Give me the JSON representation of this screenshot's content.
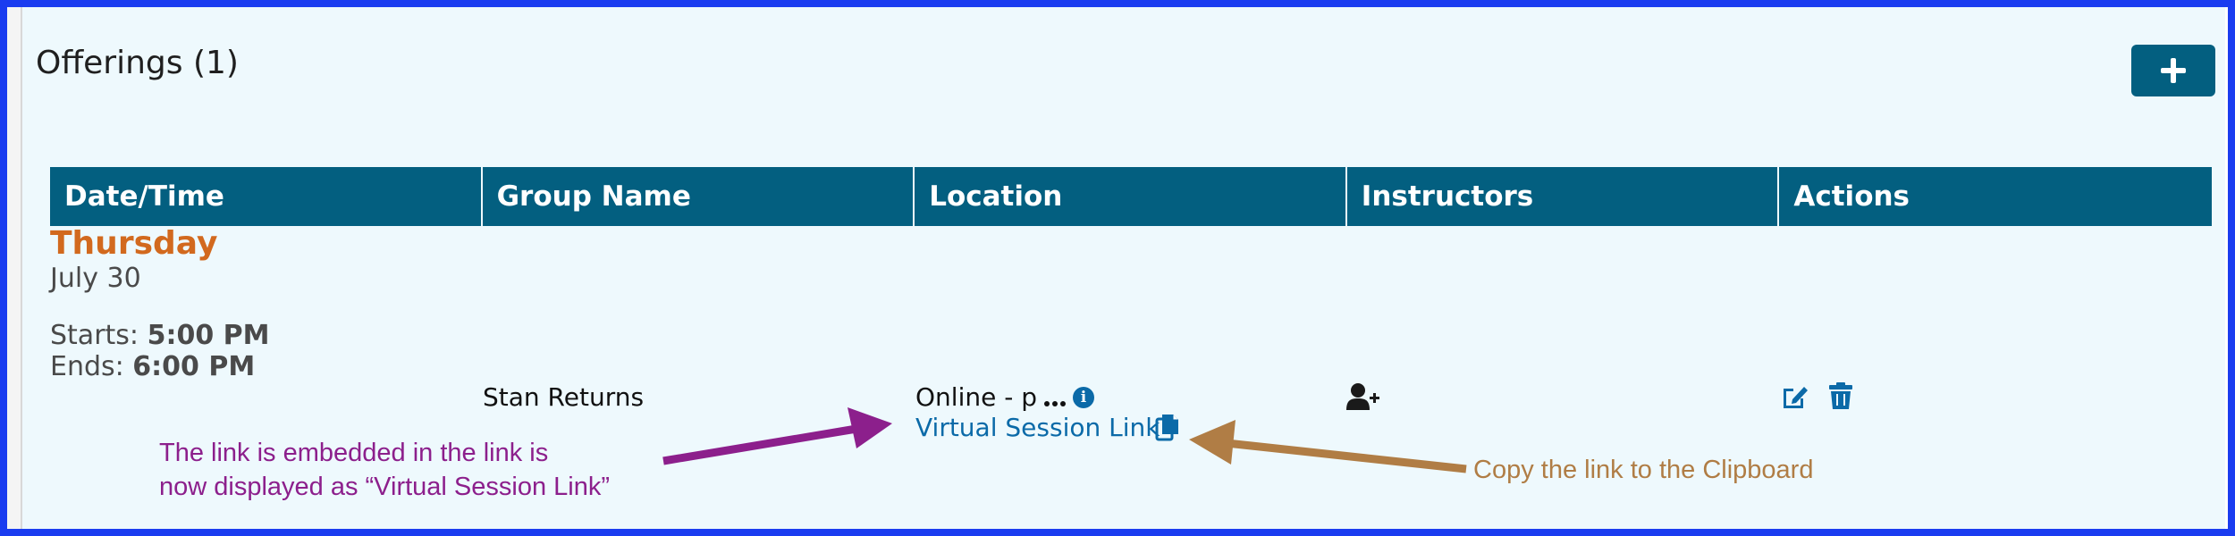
{
  "section": {
    "title": "Offerings (1)"
  },
  "table": {
    "headers": [
      "Date/Time",
      "Group Name",
      "Location",
      "Instructors",
      "Actions"
    ]
  },
  "offering": {
    "day": "Thursday",
    "date": "July 30",
    "starts_label": "Starts:",
    "starts_time": "5:00 PM",
    "ends_label": "Ends:",
    "ends_time": "6:00 PM",
    "group_name": "Stan Returns",
    "location_text": "Online - p",
    "virtual_link_label": "Virtual Session Link"
  },
  "annotations": {
    "left_line1": "The link is embedded in the link is",
    "left_line2": "now displayed as “Virtual Session Link”",
    "right": "Copy the link to the Clipboard"
  },
  "icons": {
    "add": "plus-icon",
    "info": "info-icon",
    "copy": "copy-icon",
    "instructor": "add-person-icon",
    "edit": "edit-icon",
    "delete": "trash-icon"
  },
  "colors": {
    "header_bg": "#035f80",
    "day_color": "#d2691e",
    "link_color": "#0b6aa8",
    "annotation_left": "#8c1f8c",
    "annotation_right": "#b07d45",
    "frame": "#1a3cf0"
  }
}
